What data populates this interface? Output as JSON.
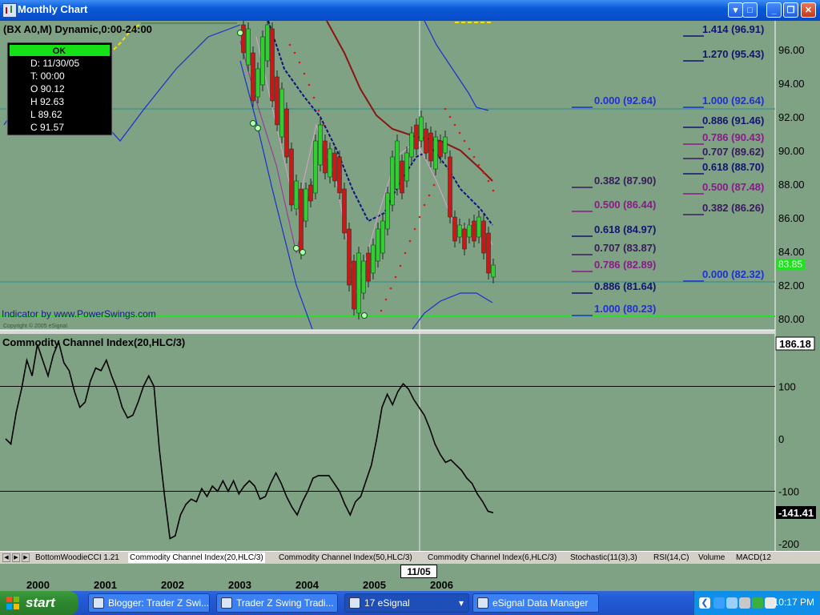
{
  "window": {
    "title": "Monthly Chart"
  },
  "chart": {
    "header": "(BX A0,M) Dynamic,0:00-24:00",
    "indicator_credit": "Indicator by www.PowerSwings.com",
    "copyright": "Copyright © 2005 eSignal",
    "info_box": {
      "status": "OK",
      "lines": [
        "D: 11/30/05",
        "T: 00:00",
        "O 90.12",
        "H 92.63",
        "L 89.62",
        "C 91.57"
      ]
    },
    "current_price_label": "83.85",
    "price_axis": [
      "96.00",
      "94.00",
      "92.00",
      "90.00",
      "88.00",
      "86.00",
      "84.00",
      "82.00",
      "80.00"
    ],
    "fib_levels": [
      {
        "text": "1.414 (96.91)",
        "color": "#14146e"
      },
      {
        "text": "1.270 (95.43)",
        "color": "#14146e"
      },
      {
        "text": "0.000 (92.64)",
        "color": "#1f2fd8"
      },
      {
        "text": "1.000 (92.64)",
        "color": "#1f2fd8"
      },
      {
        "text": "0.886 (91.46)",
        "color": "#14146e"
      },
      {
        "text": "0.786 (90.43)",
        "color": "#8a1a8a"
      },
      {
        "text": "0.707 (89.62)",
        "color": "#3a1a5e"
      },
      {
        "text": "0.618 (88.70)",
        "color": "#14146e"
      },
      {
        "text": "0.382 (87.90)",
        "color": "#3a1a5e"
      },
      {
        "text": "0.500 (87.48)",
        "color": "#8a1a8a"
      },
      {
        "text": "0.500 (86.44)",
        "color": "#8a1a8a"
      },
      {
        "text": "0.382 (86.26)",
        "color": "#3a1a5e"
      },
      {
        "text": "0.618 (84.97)",
        "color": "#14146e"
      },
      {
        "text": "0.707 (83.87)",
        "color": "#3a1a5e"
      },
      {
        "text": "0.786 (82.89)",
        "color": "#8a1a8a"
      },
      {
        "text": "0.000 (82.32)",
        "color": "#1f2fd8"
      },
      {
        "text": "0.886 (81.64)",
        "color": "#14146e"
      },
      {
        "text": "1.000 (80.23)",
        "color": "#1f2fd8"
      }
    ]
  },
  "cci": {
    "title": "Commodity Channel Index(20,HLC/3)",
    "axis": [
      "100",
      "0",
      "-100",
      "-200"
    ],
    "cursor_value": "186.18",
    "last_value": "-141.41",
    "values": [
      0,
      -10,
      50,
      95,
      150,
      120,
      180,
      150,
      120,
      160,
      185,
      145,
      130,
      90,
      60,
      70,
      110,
      135,
      130,
      150,
      120,
      95,
      60,
      40,
      45,
      70,
      100,
      120,
      100,
      -20,
      -110,
      -190,
      -185,
      -145,
      -125,
      -115,
      -120,
      -95,
      -110,
      -90,
      -100,
      -80,
      -100,
      -80,
      -105,
      -90,
      -80,
      -90,
      -115,
      -110,
      -85,
      -65,
      -85,
      -110,
      -130,
      -145,
      -120,
      -100,
      -75,
      -70,
      -70,
      -70,
      -85,
      -100,
      -125,
      -145,
      -120,
      -110,
      -80,
      -50,
      0,
      60,
      85,
      65,
      90,
      105,
      95,
      75,
      60,
      45,
      20,
      -10,
      -30,
      -45,
      -40,
      -50,
      -60,
      -75,
      -85,
      -105,
      -120,
      -138,
      -141
    ]
  },
  "x_axis": {
    "labels": [
      "2000",
      "2001",
      "2002",
      "2003",
      "2004",
      "2005",
      "2006"
    ],
    "cursor_label": "11/05"
  },
  "tabs": [
    "BottomWoodieCCI 1.21",
    "Commodity Channel Index(20,HLC/3)",
    "Commodity Channel Index(50,HLC/3)",
    "Commodity Channel Index(6,HLC/3)",
    "Stochastic(11(3),3)",
    "RSI(14,C)",
    "Volume",
    "MACD(12"
  ],
  "taskbar": {
    "start": "start",
    "items": [
      "Blogger: Trader Z Swi...",
      "Trader Z Swing Tradi...",
      "17 eSignal",
      "eSignal Data Manager"
    ],
    "clock": "10:17 PM"
  },
  "colors": {
    "chart_bg": "#7fa184",
    "up_candle": "#2fcf2f",
    "down_candle": "#c81818",
    "bollinger": "#1a2fd0",
    "ma_long": "#8a1515",
    "ma_short": "#12127a",
    "psar": "#e01818"
  }
}
